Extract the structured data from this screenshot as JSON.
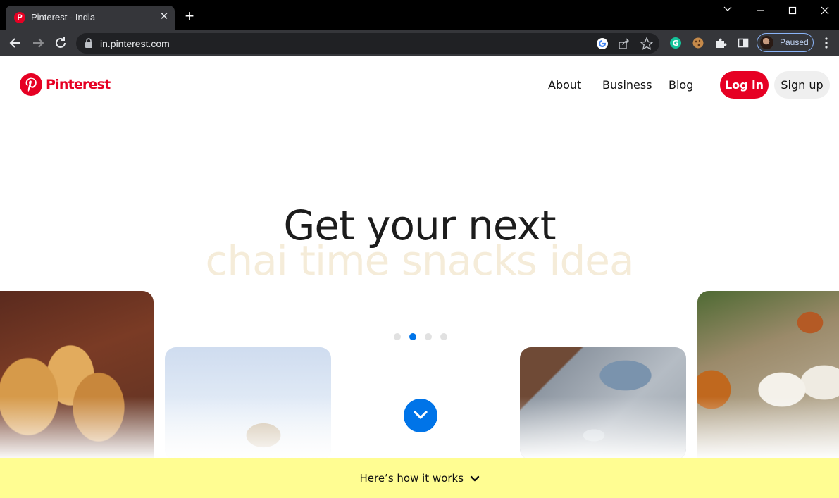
{
  "browser": {
    "tab_title": "Pinterest - India",
    "url": "in.pinterest.com",
    "profile_status": "Paused"
  },
  "header": {
    "logo_text": "Pinterest",
    "nav": [
      "About",
      "Business",
      "Blog"
    ],
    "login_label": "Log in",
    "signup_label": "Sign up"
  },
  "hero": {
    "line1": "Get your next",
    "line2": "chai time snacks idea",
    "carousel_dots": 4,
    "active_dot": 2
  },
  "footer_bar": {
    "label": "Here’s how it works"
  },
  "colors": {
    "brand_red": "#e60023",
    "accent_blue": "#0074e8",
    "banner_yellow": "#fffd92",
    "subheadline_cream": "#f5ecd9"
  }
}
